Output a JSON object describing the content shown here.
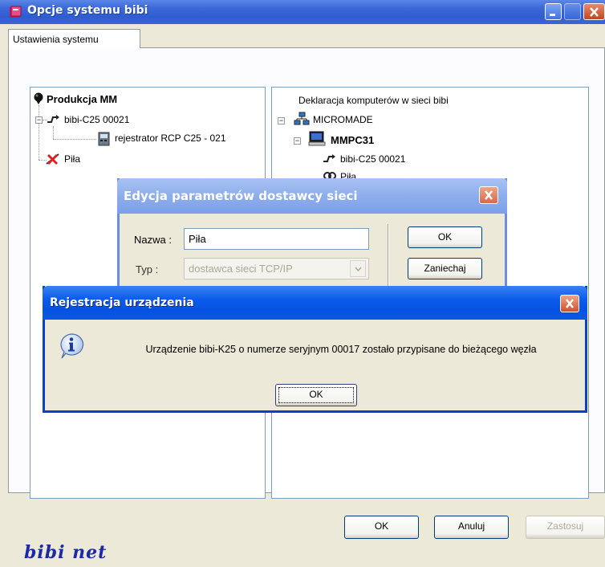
{
  "window": {
    "title": "Opcje systemu bibi"
  },
  "tabs": [
    {
      "label": "Ustawienia systemu"
    }
  ],
  "left_tree": {
    "root": "Produkcja MM",
    "items": [
      "bibi-C25 00021",
      "rejestrator RCP C25 - 021",
      "Piła"
    ]
  },
  "right_tree": {
    "header": "Deklaracja komputerów w sieci bibi",
    "domain": "MICROMADE",
    "computer": "MMPC31",
    "items": [
      "bibi-C25 00021",
      "Piła"
    ]
  },
  "footer_buttons": {
    "ok": "OK",
    "cancel": "Anuluj",
    "apply": "Zastosuj"
  },
  "brand": "bibi net",
  "edit_dialog": {
    "title": "Edycja parametrów dostawcy sieci",
    "name_label": "Nazwa :",
    "name_value": "Piła",
    "type_label": "Typ :",
    "type_value": "dostawca sieci TCP/IP",
    "ok": "OK",
    "cancel": "Zaniechaj"
  },
  "register_dialog": {
    "title": "Rejestracja urządzenia",
    "message": "Urządzenie bibi-K25 o numerze seryjnym 00017 zostało przypisane do bieżącego węzła",
    "ok": "OK"
  },
  "colors": {
    "xp_title_blue": "#0A5CEB",
    "close_red": "#D0512A",
    "window_face": "#ECE9D8",
    "brand_blue": "#1C2AA8"
  }
}
